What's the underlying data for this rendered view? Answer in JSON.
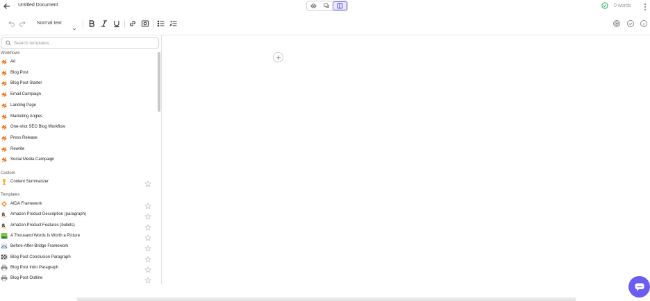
{
  "header": {
    "title": "Untitled Document",
    "word_count": "0 words",
    "views": [
      {
        "icon": "eye-icon",
        "active": false
      },
      {
        "icon": "chat-icon",
        "active": false
      },
      {
        "icon": "sidebar-layout-icon",
        "active": true
      }
    ]
  },
  "toolbar": {
    "text_style": "Normal text"
  },
  "sidebar": {
    "search_placeholder": "Search templates",
    "sections": {
      "workflows": "Workflows",
      "custom": "Custom",
      "templates": "Templates"
    },
    "workflows": [
      {
        "label": "Ad",
        "icon": "workflow-icon"
      },
      {
        "label": "Blog Post",
        "icon": "workflow-icon"
      },
      {
        "label": "Blog Post Starter",
        "icon": "workflow-icon"
      },
      {
        "label": "Email Campaign",
        "icon": "workflow-icon"
      },
      {
        "label": "Landing Page",
        "icon": "workflow-icon"
      },
      {
        "label": "Marketing Angles",
        "icon": "workflow-icon"
      },
      {
        "label": "One-shot SEO Blog Workflow",
        "icon": "workflow-icon"
      },
      {
        "label": "Press Release",
        "icon": "workflow-icon"
      },
      {
        "label": "Rewrite",
        "icon": "workflow-icon"
      },
      {
        "label": "Social Media Campaign",
        "icon": "workflow-icon"
      }
    ],
    "custom": [
      {
        "label": "Content Summarizer",
        "icon": "trophy-icon"
      }
    ],
    "templates": [
      {
        "label": "AIDA Framework",
        "icon": "aida-icon"
      },
      {
        "label": "Amazon Product Description (paragraph)",
        "icon": "amazon-icon"
      },
      {
        "label": "Amazon Product Features (bullets)",
        "icon": "amazon-icon"
      },
      {
        "label": "A Thousand Words Is Worth a Picture",
        "icon": "picture-icon"
      },
      {
        "label": "Before-After-Bridge Framework",
        "icon": "bridge-icon"
      },
      {
        "label": "Blog Post Conclusion Paragraph",
        "icon": "finish-flag-icon"
      },
      {
        "label": "Blog Post Intro Paragraph",
        "icon": "printer-icon"
      },
      {
        "label": "Blog Post Outline",
        "icon": "printer-icon"
      }
    ]
  },
  "colors": {
    "accent": "#6b5df0",
    "active_view_bg": "#ece9ff",
    "success": "#22a55a",
    "workflow_icon": "#e8731c"
  }
}
